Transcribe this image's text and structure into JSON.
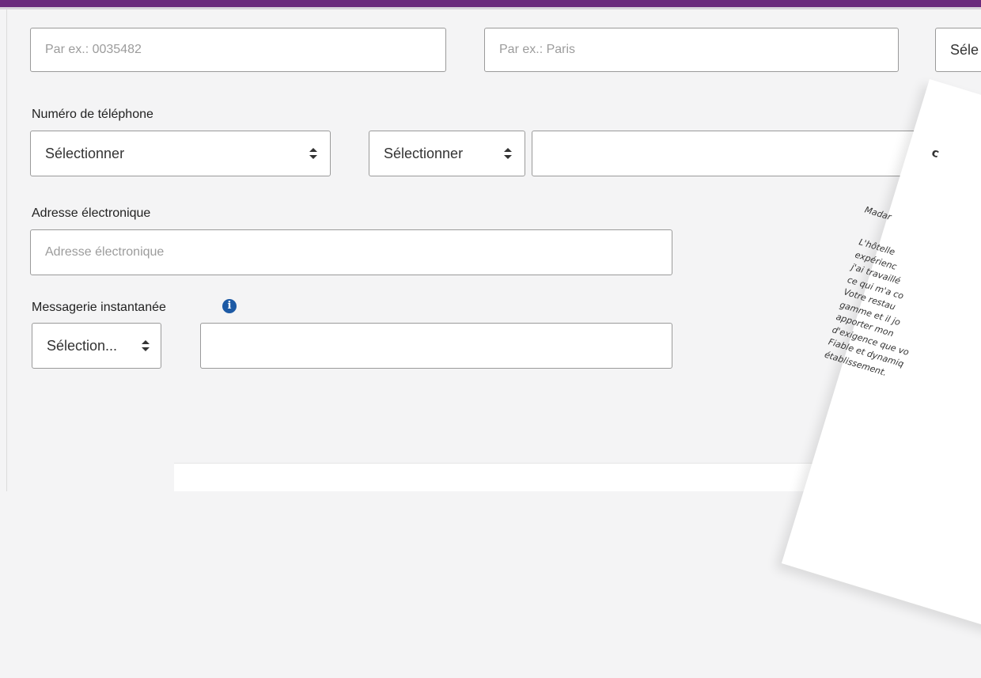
{
  "form": {
    "postal_code": {
      "placeholder": "Par ex.: 0035482"
    },
    "city": {
      "placeholder": "Par ex.: Paris"
    },
    "country_select": {
      "value": "Séle"
    },
    "phone": {
      "label": "Numéro de téléphone",
      "type_select": "Sélectionner",
      "country_code_select": "Sélectionner",
      "number": ""
    },
    "email": {
      "label": "Adresse électronique",
      "placeholder": "Adresse électronique"
    },
    "messenger": {
      "label": "Messagerie instantanée",
      "info_icon": "info-icon",
      "type_select": "Sélection...",
      "handle": ""
    }
  },
  "letter": {
    "heading": "c",
    "greeting": "Madar",
    "body_lines": [
      "L'hôtelle",
      "expérienc",
      "j'ai travaillé",
      "ce qui m'a co",
      "Votre restau",
      "gamme et il jo",
      "apporter mon",
      "d'exigence que vo",
      "Fiable et dynamiq",
      "établissement."
    ]
  },
  "colors": {
    "accent_bar": "#6b2a7d",
    "info_icon": "#1d5aa5"
  }
}
